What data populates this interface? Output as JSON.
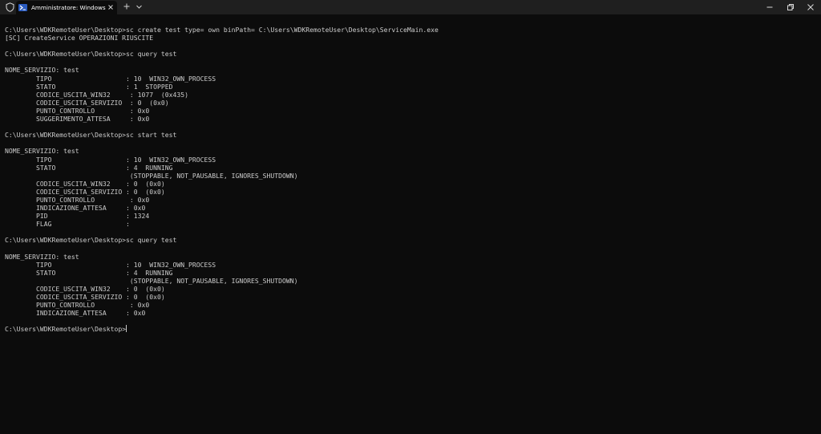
{
  "titlebar": {
    "tab_title": "Amministratore: Windows PowerShell"
  },
  "terminal": {
    "lines": [
      "C:\\Users\\WDKRemoteUser\\Desktop>sc create test type= own binPath= C:\\Users\\WDKRemoteUser\\Desktop\\ServiceMain.exe",
      "[SC] CreateService OPERAZIONI RIUSCITE",
      "",
      "C:\\Users\\WDKRemoteUser\\Desktop>sc query test",
      "",
      "NOME_SERVIZIO: test",
      "        TIPO                   : 10  WIN32_OWN_PROCESS",
      "        STATO                  : 1  STOPPED",
      "        CODICE_USCITA_WIN32     : 1077  (0x435)",
      "        CODICE_USCITA_SERVIZIO  : 0  (0x0)",
      "        PUNTO_CONTROLLO         : 0x0",
      "        SUGGERIMENTO_ATTESA     : 0x0",
      "",
      "C:\\Users\\WDKRemoteUser\\Desktop>sc start test",
      "",
      "NOME_SERVIZIO: test",
      "        TIPO                   : 10  WIN32_OWN_PROCESS",
      "        STATO                  : 4  RUNNING",
      "                                (STOPPABLE, NOT_PAUSABLE, IGNORES_SHUTDOWN)",
      "        CODICE_USCITA_WIN32    : 0  (0x0)",
      "        CODICE_USCITA_SERVIZIO : 0  (0x0)",
      "        PUNTO_CONTROLLO         : 0x0",
      "        INDICAZIONE_ATTESA     : 0x0",
      "        PID                    : 1324",
      "        FLAG                   :",
      "",
      "C:\\Users\\WDKRemoteUser\\Desktop>sc query test",
      "",
      "NOME_SERVIZIO: test",
      "        TIPO                   : 10  WIN32_OWN_PROCESS",
      "        STATO                  : 4  RUNNING",
      "                                (STOPPABLE, NOT_PAUSABLE, IGNORES_SHUTDOWN)",
      "        CODICE_USCITA_WIN32    : 0  (0x0)",
      "        CODICE_USCITA_SERVIZIO : 0  (0x0)",
      "        PUNTO_CONTROLLO         : 0x0",
      "        INDICAZIONE_ATTESA     : 0x0",
      "",
      "C:\\Users\\WDKRemoteUser\\Desktop>"
    ]
  },
  "icons": {
    "shield": "shield-icon",
    "powershell": "powershell-icon",
    "close_tab": "close-icon",
    "new_tab": "plus-icon",
    "dropdown": "chevron-down-icon",
    "minimize": "minimize-icon",
    "maximize": "restore-icon",
    "close_window": "close-icon"
  },
  "colors": {
    "background": "#0c0c0c",
    "titlebar": "#1f1f1f",
    "text": "#cccccc",
    "accent": "#2a5bbf"
  }
}
